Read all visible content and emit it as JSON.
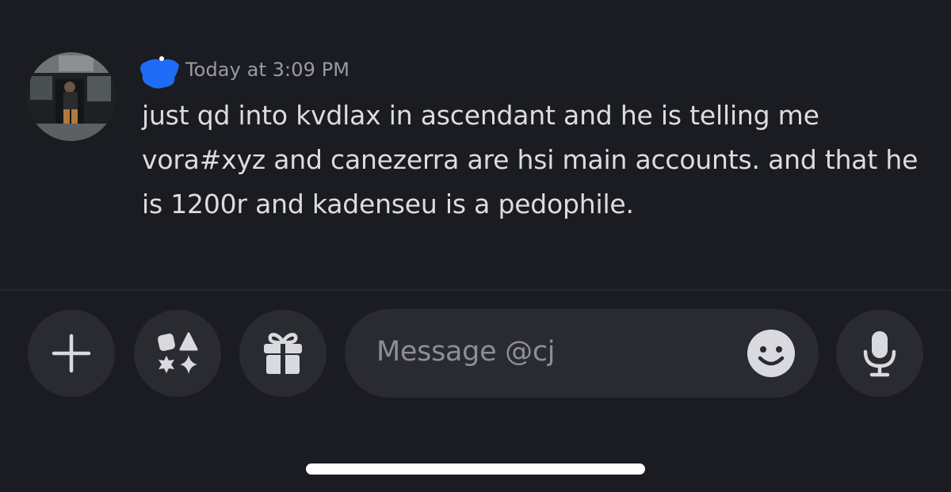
{
  "message": {
    "timestamp": "Today at 3:09 PM",
    "text": "just qd into kvdlax in ascendant and he is telling me vora#xyz and canezerra are hsi main accounts. and that he is 1200r and kadenseu is a pedophile."
  },
  "composer": {
    "placeholder": "Message @cj"
  },
  "icons": {
    "add": "plus-icon",
    "apps": "apps-icon",
    "gift": "gift-icon",
    "emoji": "emoji-icon",
    "voice": "microphone-icon"
  },
  "colors": {
    "background": "#1b1b22",
    "surface": "#2a2b31",
    "text": "#dcdde1",
    "muted": "#9a9ba2",
    "redaction": "#1e6cf5"
  }
}
